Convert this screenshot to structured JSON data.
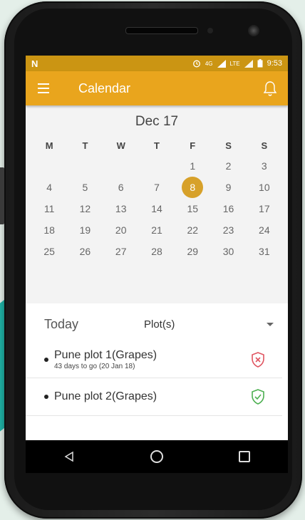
{
  "status_bar": {
    "network_badge": "N",
    "signal_labels": [
      "4G",
      "LTE"
    ],
    "time": "9:53"
  },
  "app_bar": {
    "title": "Calendar",
    "menu_icon": "hamburger-menu-icon",
    "notification_icon": "bell-icon"
  },
  "calendar": {
    "month_label": "Dec 17",
    "weekdays": [
      "M",
      "T",
      "W",
      "T",
      "F",
      "S",
      "S"
    ],
    "weeks": [
      [
        "",
        "",
        "",
        "",
        "1",
        "2",
        "3"
      ],
      [
        "4",
        "5",
        "6",
        "7",
        "8",
        "9",
        "10"
      ],
      [
        "11",
        "12",
        "13",
        "14",
        "15",
        "16",
        "17"
      ],
      [
        "18",
        "19",
        "20",
        "21",
        "22",
        "23",
        "24"
      ],
      [
        "25",
        "26",
        "27",
        "28",
        "29",
        "30",
        "31"
      ]
    ],
    "selected_day": "8"
  },
  "today_section": {
    "label": "Today",
    "dropdown_value": "Plot(s)"
  },
  "plots": [
    {
      "title": "Pune plot 1(Grapes)",
      "subtitle": "43 days to go (20 Jan 18)",
      "status_icon": "shield-x-icon",
      "status_color": "#e05561"
    },
    {
      "title": "Pune plot 2(Grapes)",
      "subtitle": "",
      "status_icon": "shield-check-icon",
      "status_color": "#4caf50"
    }
  ],
  "colors": {
    "app_bar": "#e9a51d",
    "status_bar": "#cb9513",
    "selected_day": "#d7a12a"
  }
}
